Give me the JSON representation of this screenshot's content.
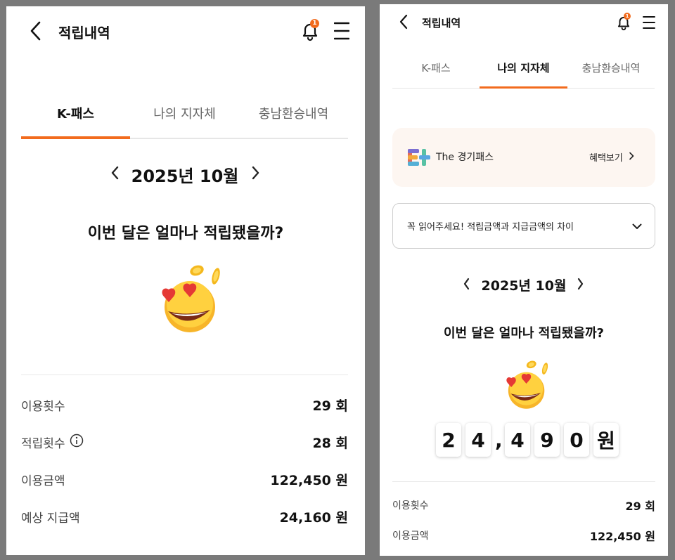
{
  "colors": {
    "accent": "#f26b1d",
    "background": "#7a7a7a",
    "promo_bg": "#fdf6f1"
  },
  "left": {
    "header": {
      "title": "적립내역",
      "notification_count": "1"
    },
    "tabs": [
      {
        "label": "K-패스",
        "active": true
      },
      {
        "label": "나의 지자체",
        "active": false
      },
      {
        "label": "충남환승내역",
        "active": false
      }
    ],
    "month": "2025년 10월",
    "question": "이번 달은 얼마나 적립됐을까?",
    "stats": [
      {
        "label": "이용횟수",
        "value": "29 회"
      },
      {
        "label": "적립횟수",
        "value": "28 회",
        "info": true
      },
      {
        "label": "이용금액",
        "value": "122,450 원"
      },
      {
        "label": "예상 지급액",
        "value": "24,160 원"
      }
    ]
  },
  "right": {
    "header": {
      "title": "적립내역",
      "notification_count": "1"
    },
    "tabs": [
      {
        "label": "K-패스",
        "active": false
      },
      {
        "label": "나의 지자체",
        "active": true
      },
      {
        "label": "충남환승내역",
        "active": false
      }
    ],
    "promo": {
      "brand": "The 경기패스",
      "link": "혜택보기"
    },
    "notice": "꼭 읽어주세요! 적립금액과 지급금액의 차이",
    "month": "2025년 10월",
    "question": "이번 달은 얼마나 적립됐을까?",
    "amount_digits": [
      "2",
      "4",
      "4",
      "9",
      "0"
    ],
    "amount_unit": "원",
    "stats": [
      {
        "label": "이용횟수",
        "value": "29 회"
      },
      {
        "label": "이용금액",
        "value": "122,450 원"
      }
    ]
  }
}
